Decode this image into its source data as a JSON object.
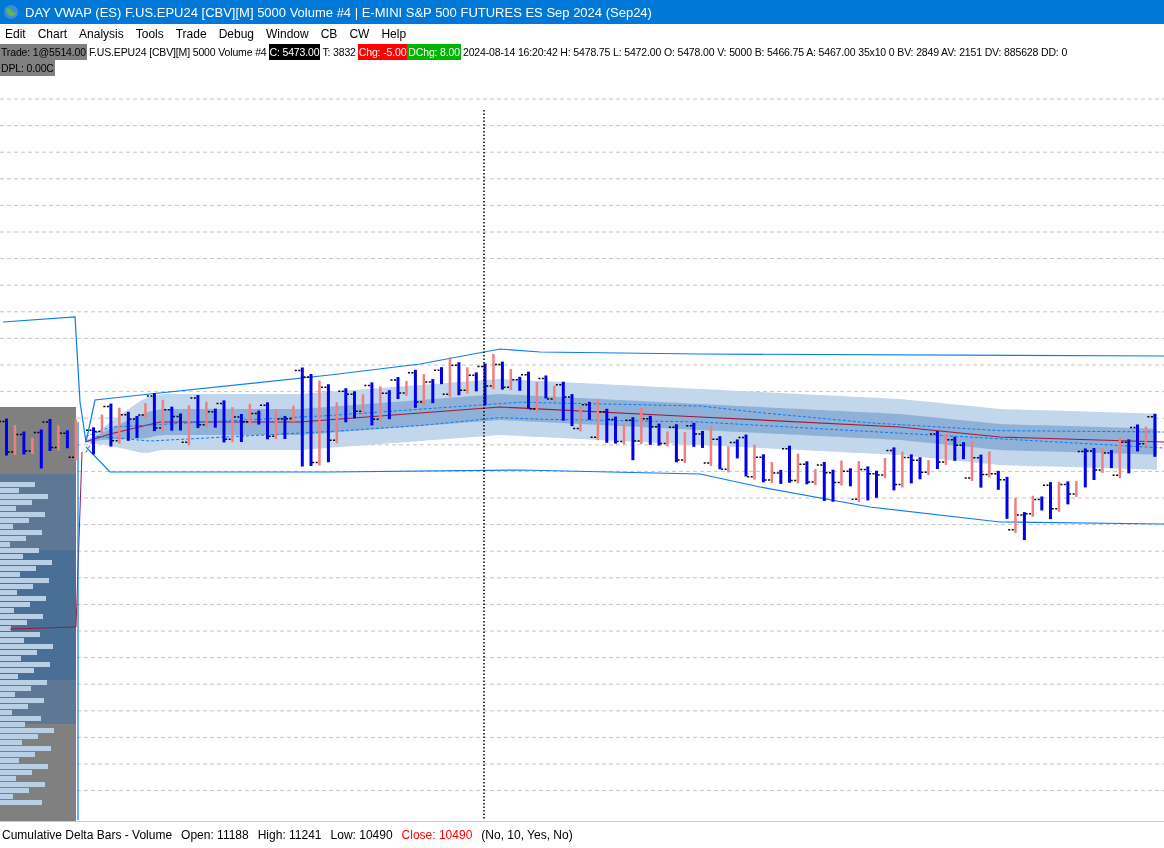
{
  "window": {
    "title": "DAY VWAP (ES) F.US.EPU24 [CBV][M]  5000 Volume #4 | E-MINI S&P 500 FUTURES ES Sep 2024 (Sep24)"
  },
  "menu": [
    "Edit",
    "Chart",
    "Analysis",
    "Tools",
    "Trade",
    "Debug",
    "Window",
    "CB",
    "CW",
    "Help"
  ],
  "quote_line": [
    {
      "text": "Trade: 1@5514.00",
      "kind": "trade"
    },
    {
      "text": "F.US.EPU24 [CBV][M]  5000 Volume #4",
      "kind": "info"
    },
    {
      "text": "C: 5473.00",
      "kind": "close"
    },
    {
      "text": "T: 3832",
      "kind": "info"
    },
    {
      "text": "Chg: -5.00",
      "kind": "change"
    },
    {
      "text": "DChg: 8.00",
      "kind": "daychange"
    },
    {
      "text": "2024-08-14 16:20:42 H: 5478.75 L: 5472.00 O: 5478.00 V: 5000 B: 5466.75 A: 5467.00 35x10 0 BV: 2849 AV: 2151 DV: 885628 DD: 0",
      "kind": "info"
    },
    {
      "text": "DPL: 0.00C",
      "kind": "pnl"
    }
  ],
  "status_bar": [
    {
      "text": "Cumulative Delta Bars - Volume",
      "kind": "info"
    },
    {
      "text": "Open: 11188",
      "kind": "info"
    },
    {
      "text": "High: 11241",
      "kind": "info"
    },
    {
      "text": "Low: 10490",
      "kind": "info"
    },
    {
      "text": "Close: 10490",
      "kind": "close"
    },
    {
      "text": "(No, 10, Yes, No)",
      "kind": "info"
    }
  ]
}
